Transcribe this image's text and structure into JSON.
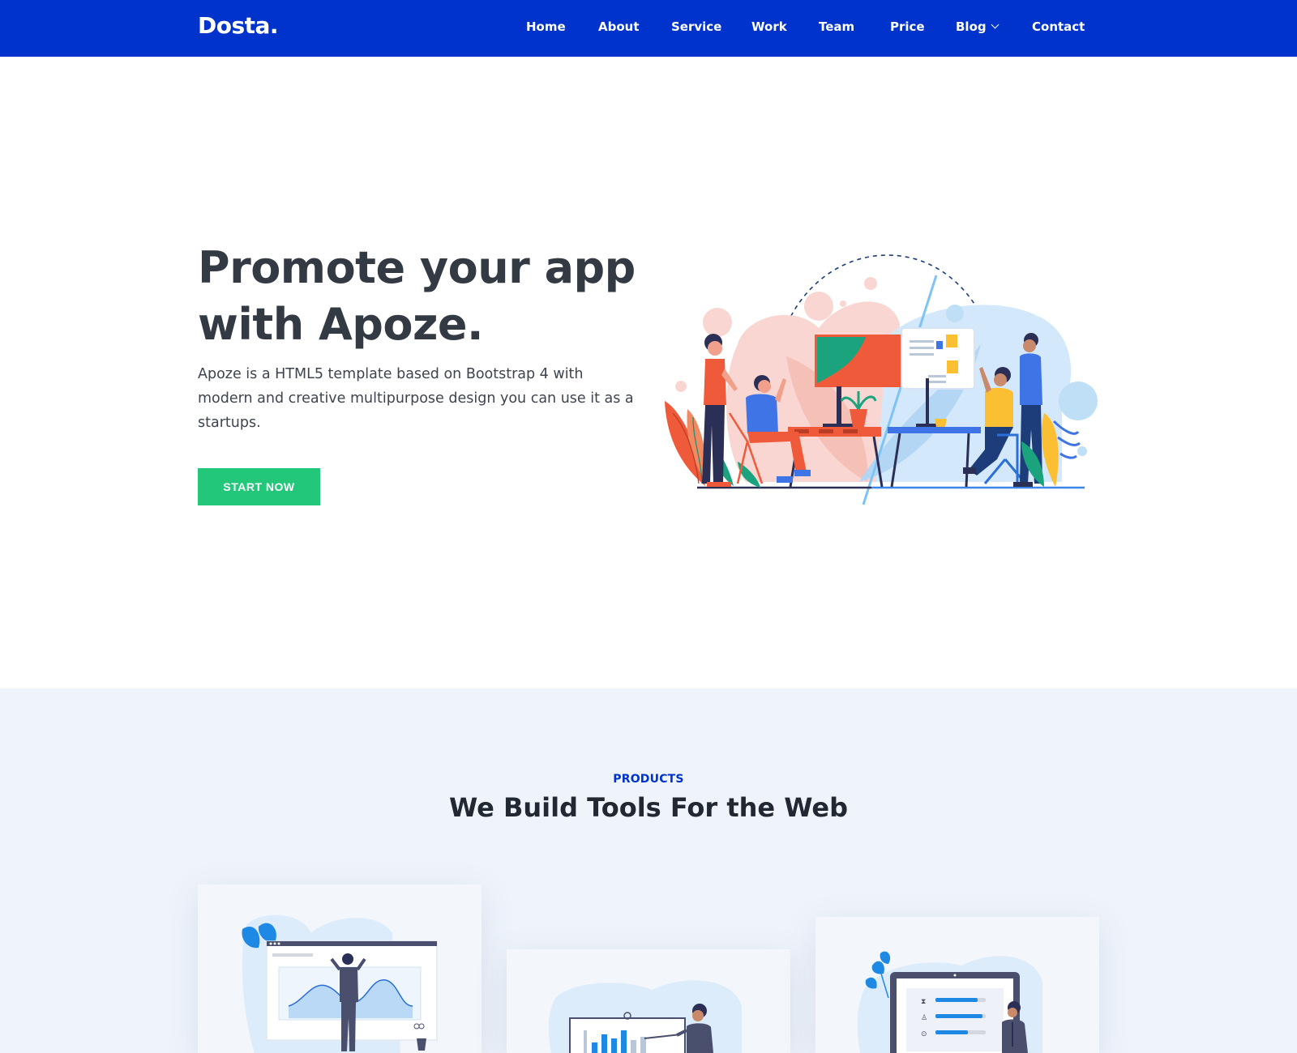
{
  "brand": {
    "logo": "Dosta."
  },
  "nav": {
    "items": [
      {
        "label": "Home"
      },
      {
        "label": "About"
      },
      {
        "label": "Service"
      },
      {
        "label": "Work"
      },
      {
        "label": "Team"
      },
      {
        "label": "Price"
      },
      {
        "label": "Blog",
        "icon": "chevron-down-icon"
      },
      {
        "label": "Contact"
      }
    ]
  },
  "hero": {
    "title_line1": "Promote your app",
    "title_line2": "with Apoze.",
    "description": "Apoze is a HTML5 template based on Bootstrap 4 with modern and creative multipurpose design you can use it as a startups.",
    "cta_label": "START NOW",
    "illustration": "team-office-illustration"
  },
  "products": {
    "eyebrow": "PRODUCTS",
    "title": "We Build Tools For the Web",
    "cards": [
      {
        "illustration": "analytics-presentation-illustration"
      },
      {
        "illustration": "bar-chart-presentation-illustration"
      },
      {
        "illustration": "progress-dashboard-illustration"
      }
    ]
  },
  "colors": {
    "navbar": "#0033cc",
    "cta": "#22c77a",
    "heading": "#333a44",
    "section_bg": "#eff4fb",
    "accent": "#0033cc"
  }
}
